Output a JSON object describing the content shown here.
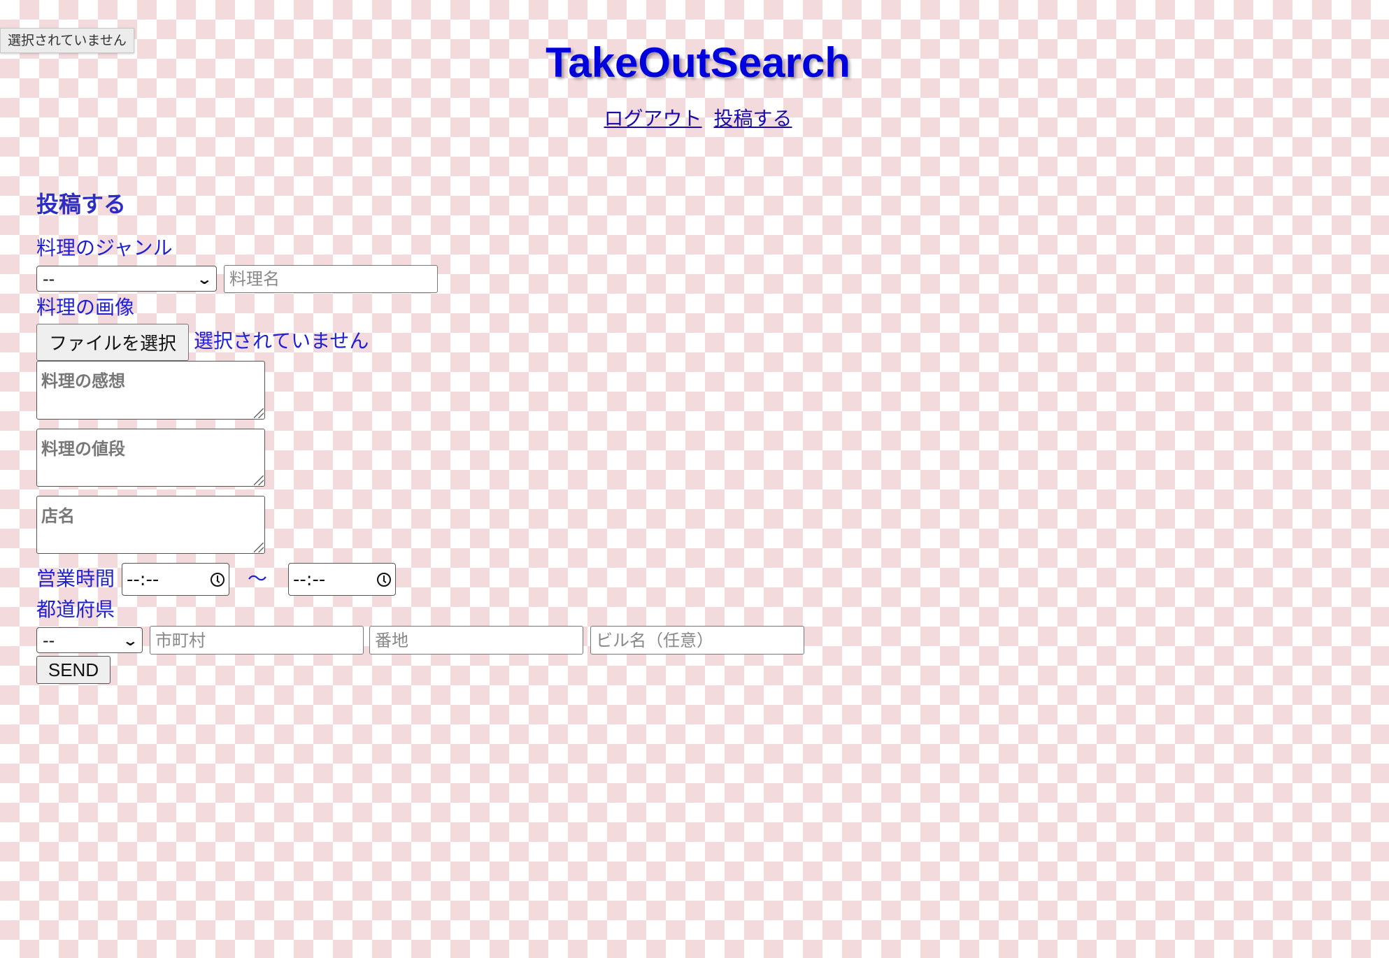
{
  "tooltip": {
    "text": "選択されていません"
  },
  "site_title": "TakeOutSearch",
  "nav": {
    "logout": "ログアウト",
    "post": "投稿する"
  },
  "form": {
    "heading": "投稿する",
    "genre_label": "料理のジャンル",
    "genre_selected": "--",
    "dish_name_placeholder": "料理名",
    "image_label": "料理の画像",
    "file_button": "ファイルを選択",
    "file_status": "選択されていません",
    "impression_placeholder": "料理の感想",
    "price_placeholder": "料理の値段",
    "shop_placeholder": "店名",
    "hours_label": "営業時間",
    "open_time": "--:--",
    "tilde": "〜",
    "close_time": "--:--",
    "prefecture_label": "都道府県",
    "prefecture_selected": "--",
    "city_placeholder": "市町村",
    "address_placeholder": "番地",
    "building_placeholder": "ビル名（任意）",
    "send_button": "SEND"
  },
  "colors": {
    "title": "#0000dd",
    "label": "#1f1fd4",
    "link": "#1a0dab",
    "checker": "#f3dadd"
  }
}
